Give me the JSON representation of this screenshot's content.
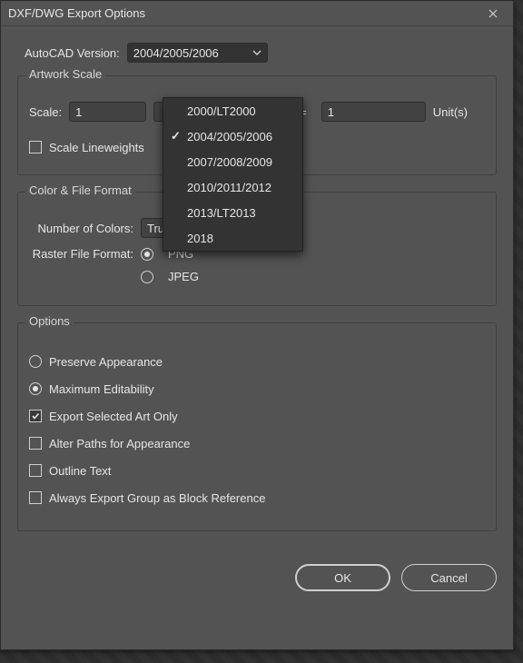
{
  "title": "DXF/DWG Export Options",
  "version": {
    "label": "AutoCAD Version:",
    "selected": "2004/2005/2006",
    "options": [
      "2000/LT2000",
      "2004/2005/2006",
      "2007/2008/2009",
      "2010/2011/2012",
      "2013/LT2013",
      "2018"
    ]
  },
  "artwork": {
    "title": "Artwork Scale",
    "scale_label": "Scale:",
    "scale_value": "1",
    "equals": "=",
    "units_value": "1",
    "units_label": "Unit(s)",
    "scale_lineweights": "Scale Lineweights"
  },
  "colorfile": {
    "title": "Color & File Format",
    "num_colors_label": "Number of Colors:",
    "num_colors_value": "True Color",
    "raster_label": "Raster File Format:",
    "png": "PNG",
    "jpeg": "JPEG"
  },
  "options": {
    "title": "Options",
    "preserve": "Preserve Appearance",
    "maxedit": "Maximum Editability",
    "selected_only": "Export Selected Art Only",
    "alter_paths": "Alter Paths for Appearance",
    "outline_text": "Outline Text",
    "block_ref": "Always Export Group as Block Reference"
  },
  "buttons": {
    "ok": "OK",
    "cancel": "Cancel"
  }
}
